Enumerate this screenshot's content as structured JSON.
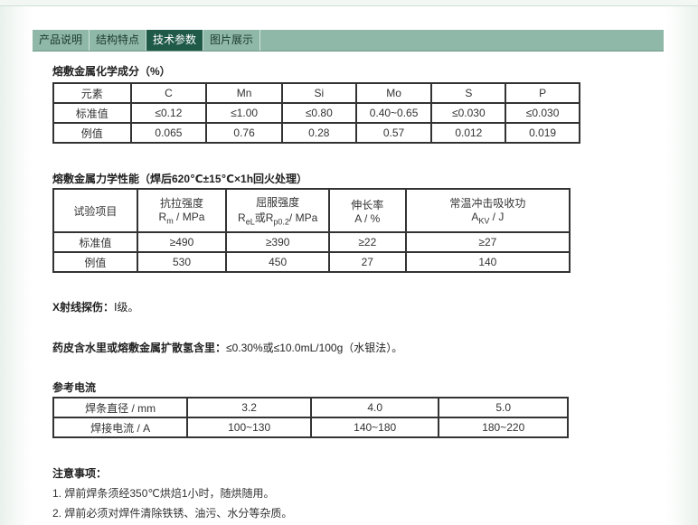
{
  "tabs": [
    "产品说明",
    "结构特点",
    "技术参数",
    "图片展示"
  ],
  "chem": {
    "title": "熔敷金属化学成分（%）",
    "header": [
      "元素",
      "C",
      "Mn",
      "Si",
      "Mo",
      "S",
      "P"
    ],
    "rows": [
      [
        "标准值",
        "≤0.12",
        "≤1.00",
        "≤0.80",
        "0.40~0.65",
        "≤0.030",
        "≤0.030"
      ],
      [
        "例值",
        "0.065",
        "0.76",
        "0.28",
        "0.57",
        "0.012",
        "0.019"
      ]
    ]
  },
  "mech": {
    "title": "熔敷金属力学性能（焊后620℃±15℃×1h回火处理）",
    "col0": "试验项目",
    "col1_line1": "抗拉强度",
    "col1_sym": "R",
    "col1_sub": "m",
    "col1_unit": " / MPa",
    "col2_line1": "屈服强度",
    "col2_sym1": "R",
    "col2_sub1": "eL",
    "col2_or": "或",
    "col2_sym2": "R",
    "col2_sub2": "p0.2",
    "col2_unit": "/ MPa",
    "col3_line1": "伸长率",
    "col3_line2": "A / %",
    "col4_line1": "常温冲击吸收功",
    "col4_sym": "A",
    "col4_sub": "KV",
    "col4_unit": " / J",
    "rows": [
      [
        "标准值",
        "≥490",
        "≥390",
        "≥22",
        "≥27"
      ],
      [
        "例值",
        "530",
        "450",
        "27",
        "140"
      ]
    ]
  },
  "xray": {
    "label": "X射线探伤：",
    "value": "Ⅰ级。"
  },
  "moisture": {
    "label": "药皮含水里或熔敷金属扩散氢含里：",
    "value": "≤0.30%或≤10.0mL/100g（水银法）。"
  },
  "current": {
    "title": "参考电流",
    "rows": [
      [
        "焊条直径 / mm",
        "3.2",
        "4.0",
        "5.0"
      ],
      [
        "焊接电流 / A",
        "100~130",
        "140~180",
        "180~220"
      ]
    ]
  },
  "notes": {
    "title": "注意事项：",
    "items": [
      "1. 焊前焊条须经350℃烘焙1小时，随烘随用。",
      "2. 焊前必须对焊件清除铁锈、油污、水分等杂质。"
    ]
  }
}
